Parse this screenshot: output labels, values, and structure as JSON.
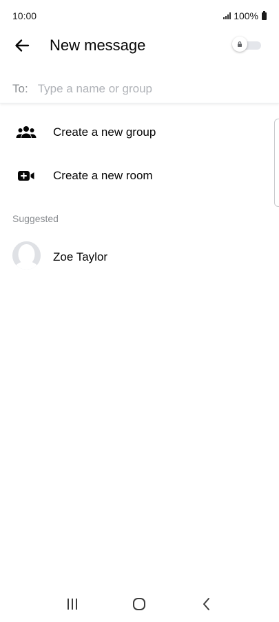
{
  "status_bar": {
    "time": "10:00",
    "battery": "100%"
  },
  "header": {
    "title": "New message",
    "back_icon": "arrow-left-icon",
    "toggle_icon": "lock-icon",
    "toggle_on": false
  },
  "recipient": {
    "label": "To:",
    "placeholder": "Type a name or group",
    "value": ""
  },
  "actions": [
    {
      "label": "Create a new group",
      "icon": "group-icon"
    },
    {
      "label": "Create a new room",
      "icon": "video-add-icon"
    }
  ],
  "suggested": {
    "heading": "Suggested",
    "contacts": [
      {
        "name": "Zoe Taylor",
        "icon": "avatar-placeholder"
      }
    ]
  },
  "nav_bar": {
    "icons": [
      "recents-icon",
      "home-icon",
      "back-icon"
    ]
  },
  "colors": {
    "text": "#050505",
    "secondary_text": "#8a8d91",
    "placeholder": "#b0b3b8",
    "toggle_track": "#e4e6eb"
  }
}
